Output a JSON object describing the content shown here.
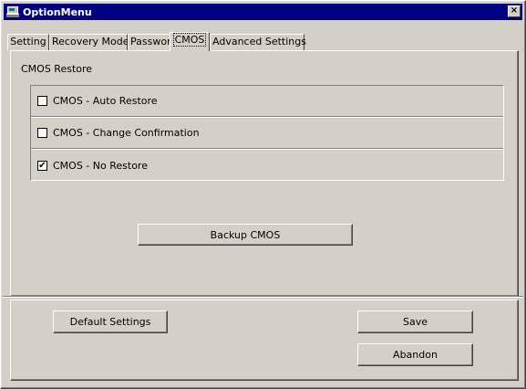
{
  "window": {
    "title": "OptionMenu",
    "close_glyph": "×"
  },
  "tabs": [
    {
      "label": "Setting",
      "active": false
    },
    {
      "label": "Recovery Mode",
      "active": false
    },
    {
      "label": "Password",
      "active": false
    },
    {
      "label": "CMOS",
      "active": true
    },
    {
      "label": "Advanced Settings",
      "active": false
    }
  ],
  "cmos": {
    "section_label": "CMOS Restore",
    "options": [
      {
        "label": "CMOS - Auto Restore",
        "checked": false
      },
      {
        "label": "CMOS - Change Confirmation",
        "checked": false
      },
      {
        "label": "CMOS - No Restore",
        "checked": true
      }
    ],
    "backup_button": "Backup CMOS"
  },
  "footer": {
    "default_button": "Default Settings",
    "save_button": "Save",
    "abandon_button": "Abandon"
  },
  "colors": {
    "titlebar": "#000080",
    "face": "#d4d0c8"
  }
}
